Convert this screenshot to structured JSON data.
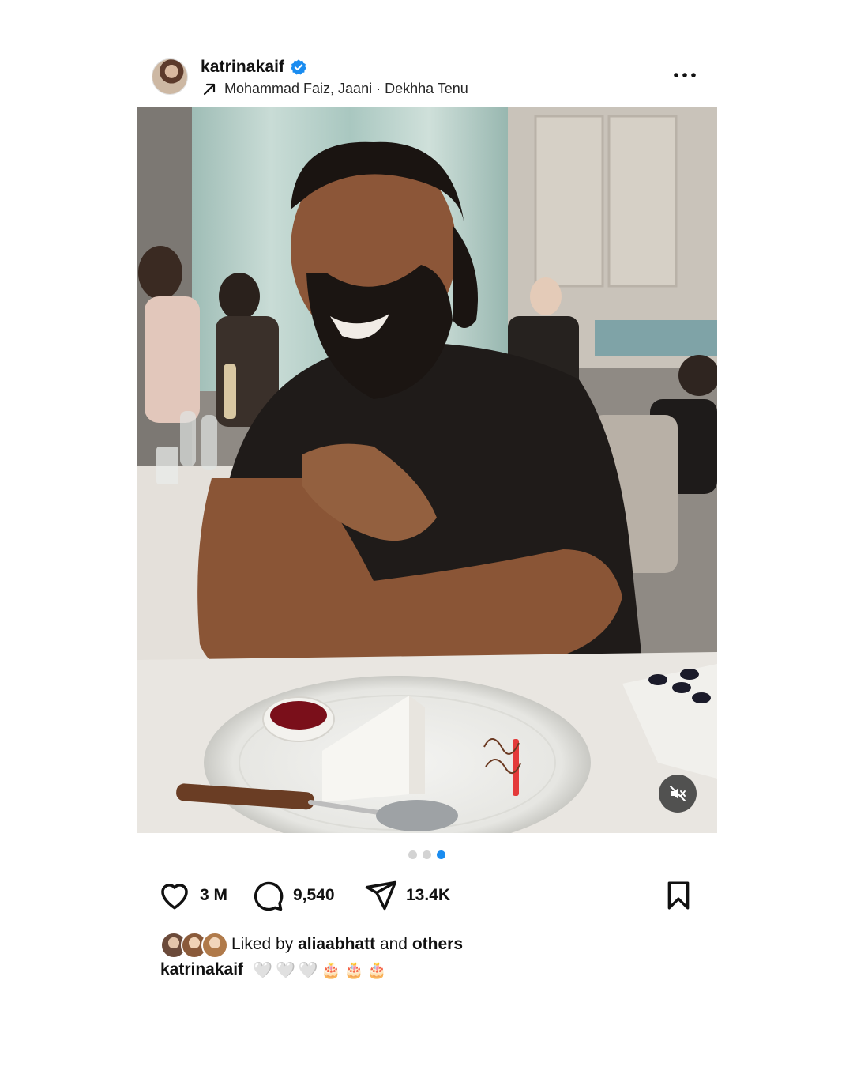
{
  "post": {
    "username": "katrinakaif",
    "audio": "Mohammad Faiz, Jaani · Dekhha Tenu",
    "avatar_icon": "profile-avatar",
    "verified_icon": "verified-badge-icon",
    "more_icon": "more-options-icon"
  },
  "media": {
    "mute_icon": "muted-speaker-icon",
    "carousel": {
      "count": 3,
      "active_index": 2
    }
  },
  "actions": {
    "likes": "3 M",
    "comments": "9,540",
    "shares": "13.4K"
  },
  "likes_line": {
    "prefix": "Liked by",
    "user": "aliaabhatt",
    "middle": "and",
    "suffix": "others"
  },
  "caption": {
    "username": "katrinakaif",
    "text": "🤍🤍🤍🎂🎂🎂"
  },
  "colors": {
    "accent_blue": "#1a8cf0",
    "text": "#111111"
  }
}
